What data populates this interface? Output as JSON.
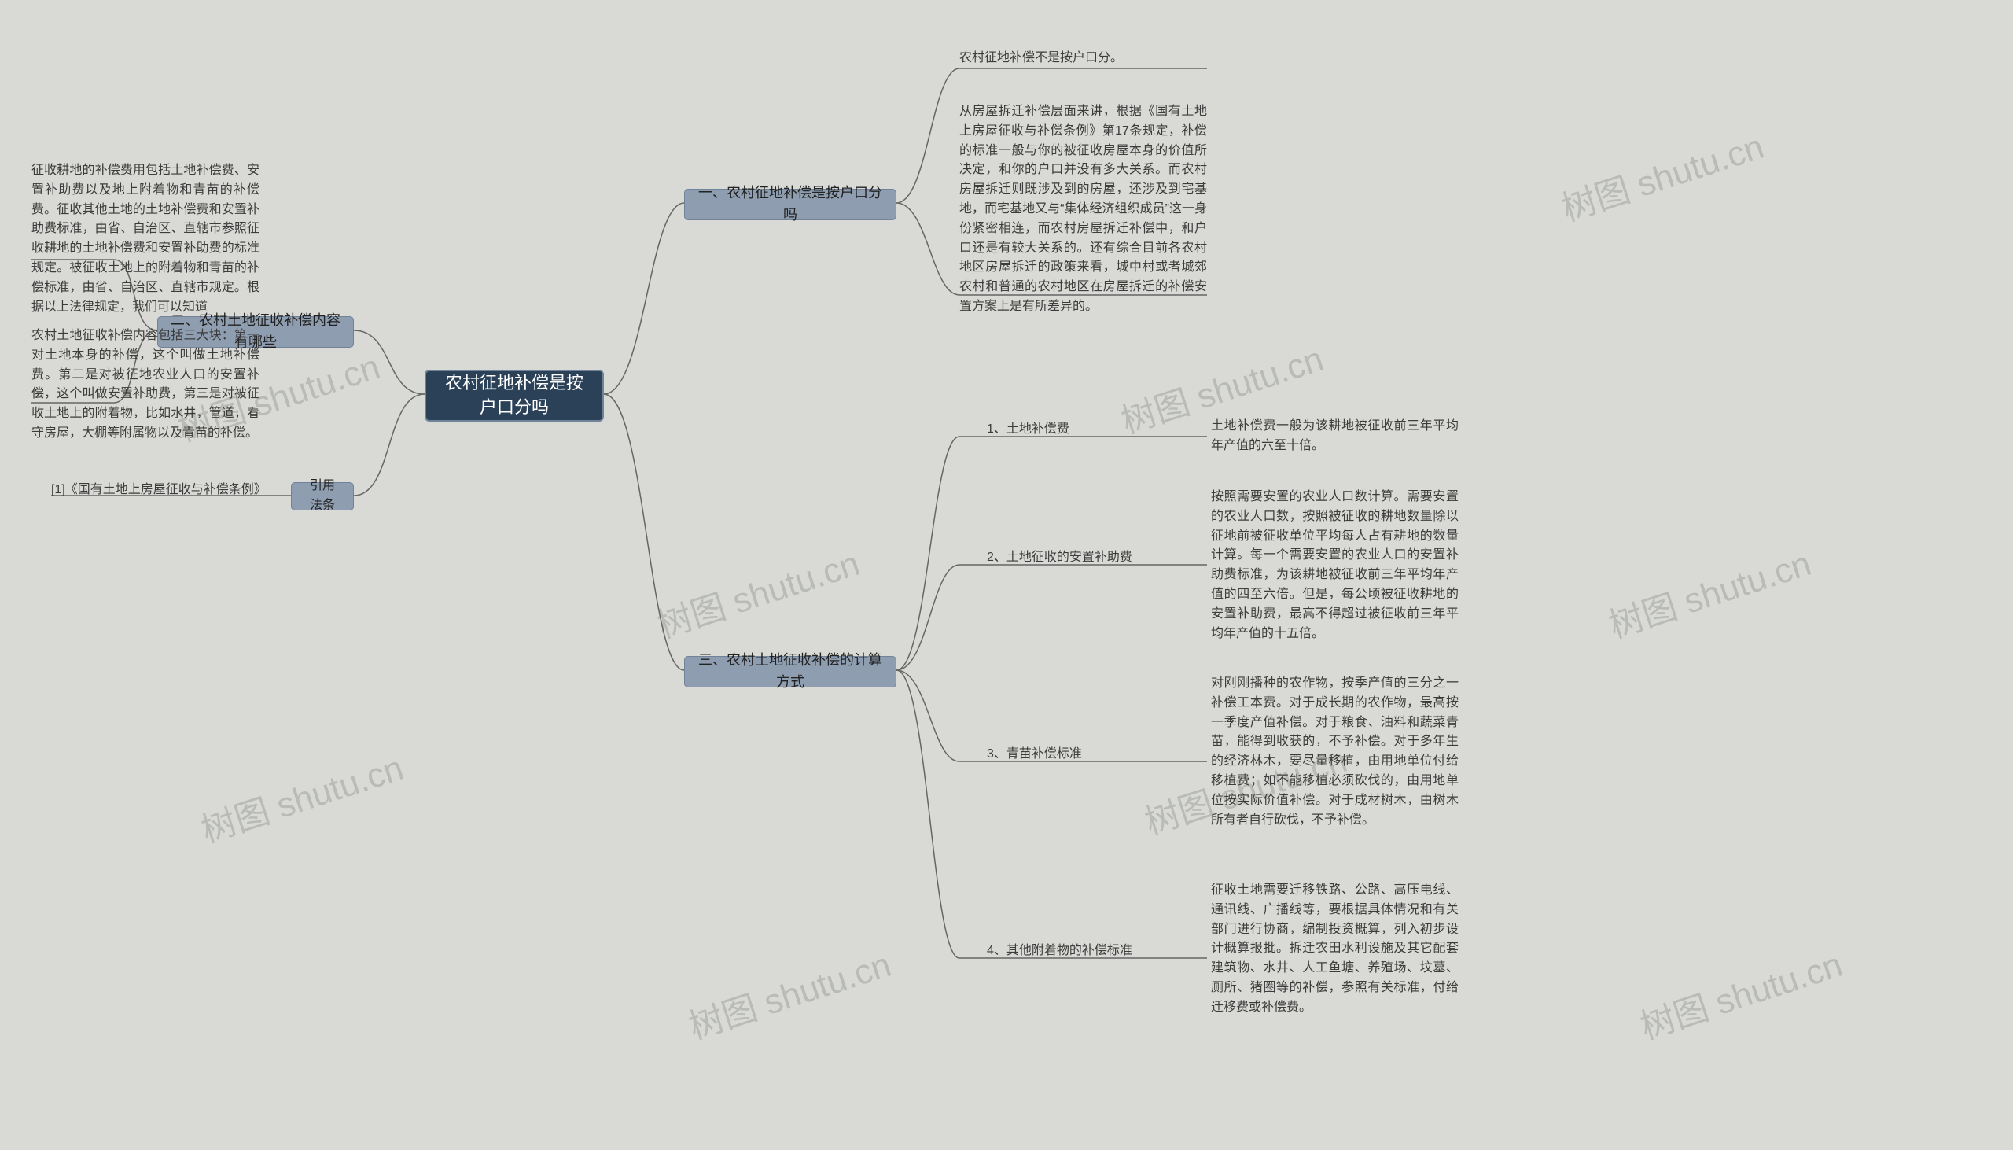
{
  "root": {
    "title": "农村征地补偿是按户口分吗"
  },
  "right": {
    "branch1": {
      "label": "一、农村征地补偿是按户口分吗",
      "leaf1": "农村征地补偿不是按户口分。",
      "leaf2": "从房屋拆迁补偿层面来讲，根据《国有土地上房屋征收与补偿条例》第17条规定，补偿的标准一般与你的被征收房屋本身的价值所决定，和你的户口并没有多大关系。而农村房屋拆迁则既涉及到的房屋，还涉及到宅基地，而宅基地又与“集体经济组织成员”这一身份紧密相连，而农村房屋拆迁补偿中，和户口还是有较大关系的。还有综合目前各农村地区房屋拆迁的政策来看，城中村或者城郊农村和普通的农村地区在房屋拆迁的补偿安置方案上是有所差异的。"
    },
    "branch3": {
      "label": "三、农村土地征收补偿的计算方式",
      "items": [
        {
          "num": "1、土地补偿费",
          "text": "土地补偿费一般为该耕地被征收前三年平均年产值的六至十倍。"
        },
        {
          "num": "2、土地征收的安置补助费",
          "text": "按照需要安置的农业人口数计算。需要安置的农业人口数，按照被征收的耕地数量除以征地前被征收单位平均每人占有耕地的数量计算。每一个需要安置的农业人口的安置补助费标准，为该耕地被征收前三年平均年产值的四至六倍。但是，每公顷被征收耕地的安置补助费，最高不得超过被征收前三年平均年产值的十五倍。"
        },
        {
          "num": "3、青苗补偿标准",
          "text": "对刚刚播种的农作物，按季产值的三分之一补偿工本费。对于成长期的农作物，最高按一季度产值补偿。对于粮食、油料和蔬菜青苗，能得到收获的，不予补偿。对于多年生的经济林木，要尽量移植，由用地单位付给移植费；如不能移植必须砍伐的，由用地单位按实际价值补偿。对于成材树木，由树木所有者自行砍伐，不予补偿。"
        },
        {
          "num": "4、其他附着物的补偿标准",
          "text": "征收土地需要迁移铁路、公路、高压电线、通讯线、广播线等，要根据具体情况和有关部门进行协商，编制投资概算，列入初步设计概算报批。拆迁农田水利设施及其它配套建筑物、水井、人工鱼塘、养殖场、坟墓、厕所、猪圈等的补偿，参照有关标准，付给迁移费或补偿费。"
        }
      ]
    }
  },
  "left": {
    "branch2": {
      "label": "二、农村土地征收补偿内容有哪些",
      "leaf1": "征收耕地的补偿费用包括土地补偿费、安置补助费以及地上附着物和青苗的补偿费。征收其他土地的土地补偿费和安置补助费标准，由省、自治区、直辖市参照征收耕地的土地补偿费和安置补助费的标准规定。被征收土地上的附着物和青苗的补偿标准，由省、自治区、直辖市规定。根据以上法律规定，我们可以知道",
      "leaf2": "农村土地征收补偿内容包括三大块：第一对土地本身的补偿，这个叫做土地补偿费。第二是对被征地农业人口的安置补偿，这个叫做安置补助费，第三是对被征收土地上的附着物，比如水井，管道，看守房屋，大棚等附属物以及青苗的补偿。"
    },
    "branch4": {
      "label": "引用法条",
      "leaf1": "[1]《国有土地上房屋征收与补偿条例》"
    }
  },
  "watermark": "树图 shutu.cn"
}
